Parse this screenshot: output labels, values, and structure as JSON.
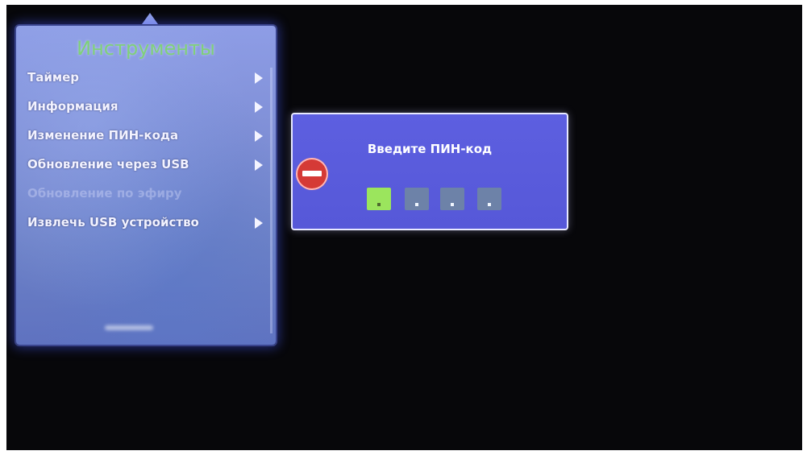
{
  "tools_menu": {
    "title": "Инструменты",
    "items": [
      {
        "label": "Таймер",
        "has_submenu": true,
        "enabled": true
      },
      {
        "label": "Информация",
        "has_submenu": true,
        "enabled": true
      },
      {
        "label": "Изменение ПИН-кода",
        "has_submenu": true,
        "enabled": true
      },
      {
        "label": "Обновление через USB",
        "has_submenu": true,
        "enabled": true
      },
      {
        "label": "Обновление по эфиру",
        "has_submenu": false,
        "enabled": false
      },
      {
        "label": "Извлечь USB устройство",
        "has_submenu": true,
        "enabled": true
      }
    ]
  },
  "pin_dialog": {
    "title": "Введите ПИН-код",
    "icon": "no-entry-icon",
    "digit_count": 4,
    "active_index": 0
  },
  "colors": {
    "menu_title": "#7fd07a",
    "dialog_bg": "#5658d8",
    "active_digit": "#9be55d",
    "inactive_digit": "#6d82a8",
    "stop_icon": "#d53a36",
    "screen_bg": "#07070a"
  }
}
